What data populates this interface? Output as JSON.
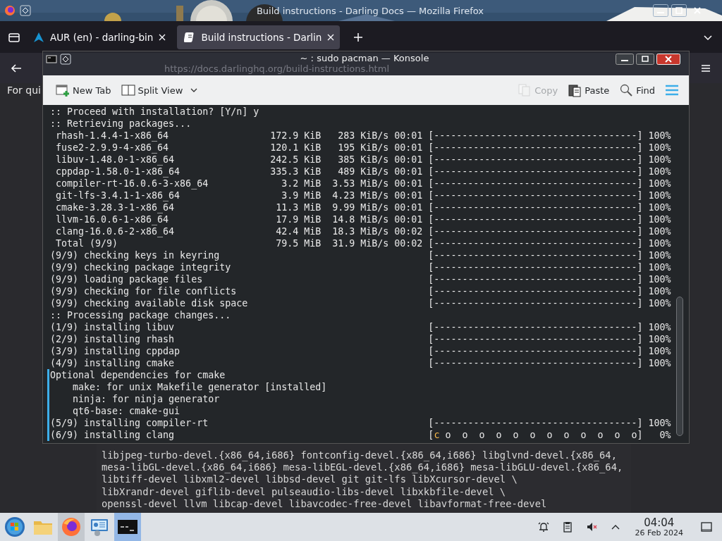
{
  "firefox": {
    "title": "Build instructions - Darling Docs — Mozilla Firefox",
    "tabs": [
      {
        "label": "AUR (en) - darling-bin",
        "selected": false
      },
      {
        "label": "Build instructions - Darlin",
        "selected": true
      }
    ],
    "url": "https://docs.darlinghq.org/build-instructions.html",
    "page_text": "For qui",
    "code_lines": [
      "libjpeg-turbo-devel.{x86_64,i686} fontconfig-devel.{x86_64,i686} libglvnd-devel.{x86_64,",
      "mesa-libGL-devel.{x86_64,i686} mesa-libEGL-devel.{x86_64,i686} mesa-libGLU-devel.{x86_64,",
      "libtiff-devel libxml2-devel libbsd-devel git git-lfs libXcursor-devel \\",
      "libXrandr-devel giflib-devel pulseaudio-libs-devel libxkbfile-devel \\",
      "openssl-devel llvm libcap-devel libavcodec-free-devel libavformat-free-devel"
    ]
  },
  "konsole": {
    "title": "~ : sudo pacman — Konsole",
    "toolbar": [
      {
        "kind": "new-tab",
        "label": "New Tab",
        "disabled": false
      },
      {
        "kind": "split-view",
        "label": "Split View",
        "disabled": false
      },
      {
        "kind": "copy",
        "label": "Copy",
        "disabled": true
      },
      {
        "kind": "paste",
        "label": "Paste",
        "disabled": false
      },
      {
        "kind": "find",
        "label": "Find",
        "disabled": false
      },
      {
        "kind": "menu",
        "disabled": false
      }
    ],
    "lines": [
      {
        "kind": "plain",
        "text": ":: Proceed with installation? [Y/n] y",
        "marked": false
      },
      {
        "kind": "plain",
        "text": ":: Retrieving packages...",
        "marked": false
      },
      {
        "kind": "download",
        "name": "rhash-1.4.4-1-x86_64",
        "size": "172.9 KiB",
        "speed": "283 KiB/s",
        "time": "00:01",
        "bar": "[------------------------------------]",
        "percent": "100%",
        "marked": false
      },
      {
        "kind": "download",
        "name": "fuse2-2.9.9-4-x86_64",
        "size": "120.1 KiB",
        "speed": "195 KiB/s",
        "time": "00:01",
        "bar": "[------------------------------------]",
        "percent": "100%",
        "marked": false
      },
      {
        "kind": "download",
        "name": "libuv-1.48.0-1-x86_64",
        "size": "242.5 KiB",
        "speed": "385 KiB/s",
        "time": "00:01",
        "bar": "[------------------------------------]",
        "percent": "100%",
        "marked": false
      },
      {
        "kind": "download",
        "name": "cppdap-1.58.0-1-x86_64",
        "size": "335.3 KiB",
        "speed": "489 KiB/s",
        "time": "00:01",
        "bar": "[------------------------------------]",
        "percent": "100%",
        "marked": false
      },
      {
        "kind": "download",
        "name": "compiler-rt-16.0.6-3-x86_64",
        "size": "3.2 MiB",
        "speed": "3.53 MiB/s",
        "time": "00:01",
        "bar": "[------------------------------------]",
        "percent": "100%",
        "marked": false
      },
      {
        "kind": "download",
        "name": "git-lfs-3.4.1-1-x86_64",
        "size": "3.9 MiB",
        "speed": "4.23 MiB/s",
        "time": "00:01",
        "bar": "[------------------------------------]",
        "percent": "100%",
        "marked": false
      },
      {
        "kind": "download",
        "name": "cmake-3.28.3-1-x86_64",
        "size": "11.3 MiB",
        "speed": "9.99 MiB/s",
        "time": "00:01",
        "bar": "[------------------------------------]",
        "percent": "100%",
        "marked": false
      },
      {
        "kind": "download",
        "name": "llvm-16.0.6-1-x86_64",
        "size": "17.9 MiB",
        "speed": "14.8 MiB/s",
        "time": "00:01",
        "bar": "[------------------------------------]",
        "percent": "100%",
        "marked": false
      },
      {
        "kind": "download",
        "name": "clang-16.0.6-2-x86_64",
        "size": "42.4 MiB",
        "speed": "18.3 MiB/s",
        "time": "00:02",
        "bar": "[------------------------------------]",
        "percent": "100%",
        "marked": false
      },
      {
        "kind": "download",
        "name": "Total (9/9)",
        "size": "79.5 MiB",
        "speed": "31.9 MiB/s",
        "time": "00:02",
        "bar": "[------------------------------------]",
        "percent": "100%",
        "marked": false
      },
      {
        "kind": "step",
        "text": "(9/9) checking keys in keyring",
        "bar": "[------------------------------------]",
        "percent": "100%",
        "marked": false
      },
      {
        "kind": "step",
        "text": "(9/9) checking package integrity",
        "bar": "[------------------------------------]",
        "percent": "100%",
        "marked": false
      },
      {
        "kind": "step",
        "text": "(9/9) loading package files",
        "bar": "[------------------------------------]",
        "percent": "100%",
        "marked": false
      },
      {
        "kind": "step",
        "text": "(9/9) checking for file conflicts",
        "bar": "[------------------------------------]",
        "percent": "100%",
        "marked": false
      },
      {
        "kind": "step",
        "text": "(9/9) checking available disk space",
        "bar": "[------------------------------------]",
        "percent": "100%",
        "marked": false
      },
      {
        "kind": "plain",
        "text": ":: Processing package changes...",
        "marked": false
      },
      {
        "kind": "step",
        "text": "(1/9) installing libuv",
        "bar": "[------------------------------------]",
        "percent": "100%",
        "marked": false
      },
      {
        "kind": "step",
        "text": "(2/9) installing rhash",
        "bar": "[------------------------------------]",
        "percent": "100%",
        "marked": false
      },
      {
        "kind": "step",
        "text": "(3/9) installing cppdap",
        "bar": "[------------------------------------]",
        "percent": "100%",
        "marked": false
      },
      {
        "kind": "step",
        "text": "(4/9) installing cmake",
        "bar": "[------------------------------------]",
        "percent": "100%",
        "marked": false
      },
      {
        "kind": "plain",
        "text": "Optional dependencies for cmake",
        "marked": true
      },
      {
        "kind": "sub",
        "text": "make: for unix Makefile generator [installed]",
        "marked": true
      },
      {
        "kind": "sub",
        "text": "ninja: for ninja generator",
        "marked": true
      },
      {
        "kind": "sub",
        "text": "qt6-base: cmake-gui",
        "marked": true
      },
      {
        "kind": "step",
        "text": "(5/9) installing compiler-rt",
        "bar": "[------------------------------------]",
        "percent": "100%",
        "marked": true
      },
      {
        "kind": "pacman",
        "text": "(6/9) installing clang",
        "bar_start": "[",
        "pacman": "c",
        "bar_rest": " o  o  o  o  o  o  o  o  o  o  o  o]",
        "percent": "0%",
        "marked": true
      }
    ]
  },
  "taskbar": {
    "apps": [
      {
        "kind": "start",
        "selected": false,
        "hovered": false
      },
      {
        "kind": "files",
        "selected": false,
        "hovered": false
      },
      {
        "kind": "browser",
        "selected": false,
        "hovered": true
      },
      {
        "kind": "settings",
        "selected": false,
        "hovered": false
      },
      {
        "kind": "terminal",
        "selected": true,
        "hovered": false
      }
    ],
    "time": "04:04",
    "date": "26 Feb 2024"
  }
}
